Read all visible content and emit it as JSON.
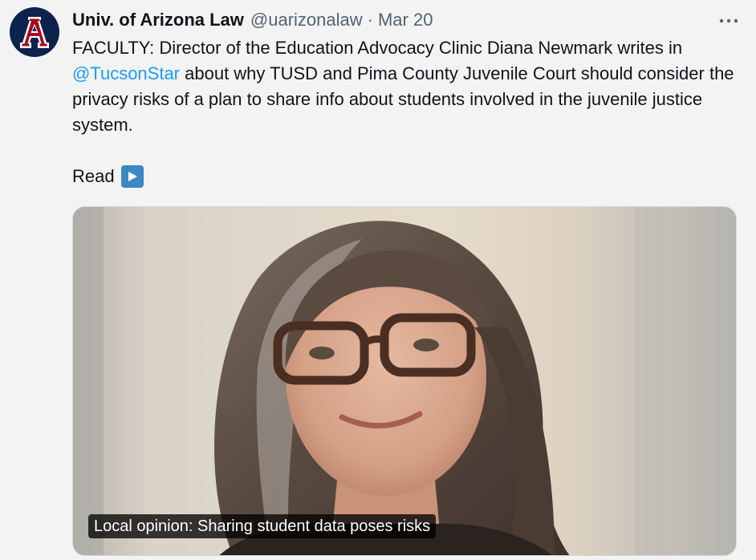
{
  "author": {
    "name": "Univ. of Arizona Law",
    "handle": "@uarizonalaw",
    "separator": "·",
    "date": "Mar 20",
    "avatar_icon": "arizona-a-logo",
    "avatar_color": "#0c234b",
    "logo_red": "#ab0520"
  },
  "more_icon": "more-horizontal-icon",
  "tweet": {
    "text_part1": "FACULTY: Director of the Education Advocacy Clinic Diana Newmark writes in ",
    "mention": "@TucsonStar",
    "text_part2": " about why TUSD and Pima County Juvenile Court should consider the privacy risks of a plan to share info about students involved in the juvenile justice system.",
    "read_label": "Read",
    "read_icon": "play-button-emoji"
  },
  "link_card": {
    "caption": "Local opinion: Sharing student data poses risks",
    "image_icon": "portrait-photo"
  },
  "colors": {
    "text": "#0f1419",
    "secondary": "#536471",
    "link": "#1d9bf0",
    "background": "#f3f3f3"
  }
}
